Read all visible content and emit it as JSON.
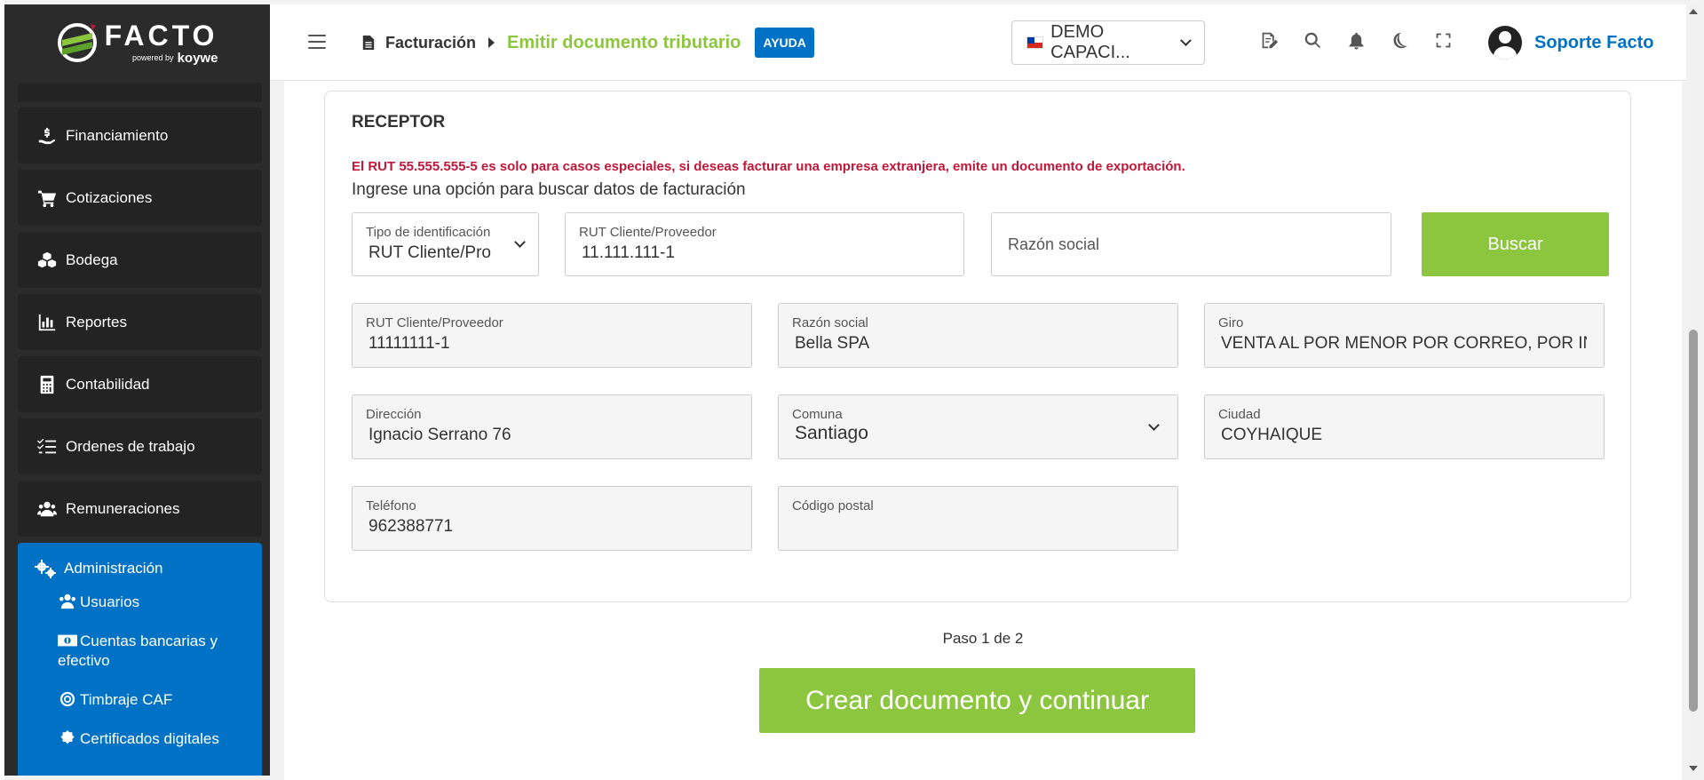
{
  "brand": {
    "name": "FACTO",
    "powered": "powered by",
    "partner": "koywe",
    "accent": "#8cc63f",
    "primary": "#0072c6"
  },
  "sidebar": {
    "items": [
      {
        "label": "Financiamiento",
        "icon": "hand-money-icon"
      },
      {
        "label": "Cotizaciones",
        "icon": "cart-icon"
      },
      {
        "label": "Bodega",
        "icon": "boxes-icon"
      },
      {
        "label": "Reportes",
        "icon": "bar-chart-icon"
      },
      {
        "label": "Contabilidad",
        "icon": "calculator-icon"
      },
      {
        "label": "Ordenes de trabajo",
        "icon": "list-check-icon"
      },
      {
        "label": "Remuneraciones",
        "icon": "users-icon"
      }
    ],
    "admin": {
      "label": "Administración",
      "sub": [
        {
          "label": "Usuarios"
        },
        {
          "label": "Cuentas bancarias y efectivo"
        },
        {
          "label": "Timbraje CAF"
        },
        {
          "label": "Certificados digitales"
        }
      ]
    }
  },
  "header": {
    "breadcrumb": {
      "section": "Facturación",
      "current": "Emitir documento tributario"
    },
    "help": "AYUDA",
    "company": "DEMO CAPACI...",
    "user": "Soporte Facto"
  },
  "receptor": {
    "title": "RECEPTOR",
    "warning": "El RUT 55.555.555-5 es solo para casos especiales, si deseas facturar una empresa extranjera, emite un documento de exportación.",
    "hint": "Ingrese una opción para buscar datos de facturación",
    "search": {
      "id_type_label": "Tipo de identificación",
      "id_type_value": "RUT Cliente/Pro",
      "rut_label": "RUT Cliente/Proveedor",
      "rut_value": "11.111.111-1",
      "razon_placeholder": "Razón social",
      "button": "Buscar"
    },
    "fields": {
      "rut": {
        "label": "RUT Cliente/Proveedor",
        "value": "11111111-1"
      },
      "razon": {
        "label": "Razón social",
        "value": "Bella SPA"
      },
      "giro": {
        "label": "Giro",
        "value": "VENTA AL POR MENOR POR CORREO, POR IN"
      },
      "direccion": {
        "label": "Dirección",
        "value": "Ignacio Serrano 76"
      },
      "comuna": {
        "label": "Comuna",
        "value": "Santiago"
      },
      "ciudad": {
        "label": "Ciudad",
        "value": "COYHAIQUE"
      },
      "telefono": {
        "label": "Teléfono",
        "value": "962388771"
      },
      "postal": {
        "label": "Código postal",
        "value": ""
      }
    }
  },
  "footer": {
    "step": "Paso 1 de 2",
    "submit": "Crear documento y continuar"
  }
}
